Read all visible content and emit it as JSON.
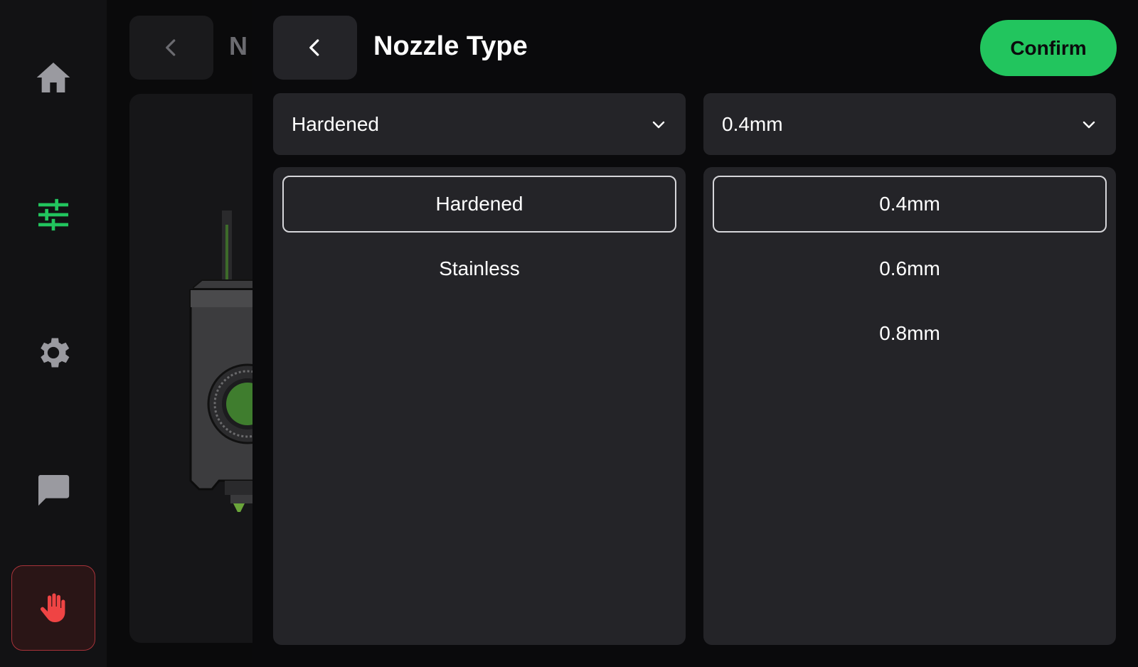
{
  "sidebar": {
    "items": [
      {
        "icon": "home-icon"
      },
      {
        "icon": "tune-icon",
        "active": true,
        "color": "#22c55e"
      },
      {
        "icon": "gear-icon"
      },
      {
        "icon": "chat-icon"
      },
      {
        "icon": "stop-hand-icon",
        "color": "#ef4444"
      }
    ]
  },
  "background_page": {
    "title": "N"
  },
  "modal": {
    "title": "Nozzle Type",
    "confirm_label": "Confirm",
    "type_dropdown": {
      "value": "Hardened",
      "options": [
        "Hardened",
        "Stainless"
      ],
      "selected": "Hardened"
    },
    "size_dropdown": {
      "value": "0.4mm",
      "options": [
        "0.4mm",
        "0.6mm",
        "0.8mm"
      ],
      "selected": "0.4mm"
    }
  },
  "colors": {
    "accent": "#22c55e",
    "danger": "#ef4444",
    "surface": "#242428",
    "background": "#0a0a0c"
  }
}
